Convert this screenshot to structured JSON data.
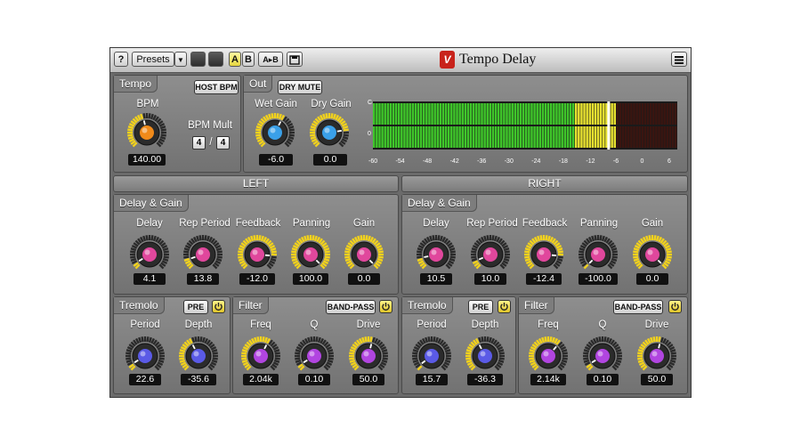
{
  "toolbar": {
    "help_label": "?",
    "presets_label": "Presets",
    "a_label": "A",
    "b_label": "B",
    "ab_label": "A▸B",
    "plugin_title": "Tempo Delay",
    "logo_letter": "V"
  },
  "tempo": {
    "title": "Tempo",
    "host_bpm_label": "HOST BPM",
    "bpm_label": "BPM",
    "bpm_value": "140.00",
    "bpm_mult_label": "BPM Mult",
    "mult_num": "4",
    "mult_sep": "/",
    "mult_den": "4"
  },
  "out": {
    "title": "Out",
    "dry_mute_label": "DRY MUTE",
    "wet_gain_label": "Wet Gain",
    "wet_gain_value": "-6.0",
    "dry_gain_label": "Dry Gain",
    "dry_gain_value": "0.0",
    "meter_channel_labels": [
      "C",
      "0"
    ],
    "meter_ticks": [
      "-60",
      "-54",
      "-48",
      "-42",
      "-36",
      "-30",
      "-24",
      "-18",
      "-12",
      "-6",
      "0",
      "6"
    ]
  },
  "left": {
    "header": "LEFT",
    "delay_gain_title": "Delay & Gain",
    "delay_label": "Delay",
    "delay_value": "4.1",
    "rep_label": "Rep Period",
    "rep_value": "13.8",
    "feedback_label": "Feedback",
    "feedback_value": "-12.0",
    "panning_label": "Panning",
    "panning_value": "100.0",
    "gain_label": "Gain",
    "gain_value": "0.0",
    "tremolo_title": "Tremolo",
    "pre_label": "PRE",
    "period_label": "Period",
    "period_value": "22.6",
    "depth_label": "Depth",
    "depth_value": "-35.6",
    "filter_title": "Filter",
    "bandpass_label": "BAND-PASS",
    "freq_label": "Freq",
    "freq_value": "2.04k",
    "q_label": "Q",
    "q_value": "0.10",
    "drive_label": "Drive",
    "drive_value": "50.0"
  },
  "right": {
    "header": "RIGHT",
    "delay_gain_title": "Delay & Gain",
    "delay_label": "Delay",
    "delay_value": "10.5",
    "rep_label": "Rep Period",
    "rep_value": "10.0",
    "feedback_label": "Feedback",
    "feedback_value": "-12.4",
    "panning_label": "Panning",
    "panning_value": "-100.0",
    "gain_label": "Gain",
    "gain_value": "0.0",
    "tremolo_title": "Tremolo",
    "pre_label": "PRE",
    "period_label": "Period",
    "period_value": "15.7",
    "depth_label": "Depth",
    "depth_value": "-36.3",
    "filter_title": "Filter",
    "bandpass_label": "BAND-PASS",
    "freq_label": "Freq",
    "freq_value": "2.14k",
    "q_label": "Q",
    "q_value": "0.10",
    "drive_label": "Drive",
    "drive_value": "50.0"
  },
  "knob_levels": {
    "bpm": 0.45,
    "wet": 0.6,
    "dry": 0.8,
    "l_delay": 0.05,
    "l_rep": 0.1,
    "l_feedback": 0.85,
    "l_panning": 1.0,
    "l_gain": 1.0,
    "l_period": 0.05,
    "l_depth": 0.4,
    "l_freq": 0.6,
    "l_q": 0.05,
    "l_drive": 0.55,
    "r_delay": 0.12,
    "r_rep": 0.08,
    "r_feedback": 0.85,
    "r_panning": 0.0,
    "r_gain": 1.0,
    "r_period": 0.03,
    "r_depth": 0.4,
    "r_freq": 0.65,
    "r_q": 0.05,
    "r_drive": 0.55
  },
  "meter_level": 0.8,
  "meter_peak": 0.77,
  "colors": {
    "accent_arc": "#f2d21c",
    "knob_orange": "#f08a1a",
    "knob_blue": "#3aa0e8",
    "knob_pink": "#e0479c",
    "knob_indigo": "#5a5ae6",
    "knob_violet": "#b145e0",
    "meter_green": "#3fc62a",
    "meter_yellow": "#e6e030",
    "meter_dark_red": "#3a1510"
  }
}
